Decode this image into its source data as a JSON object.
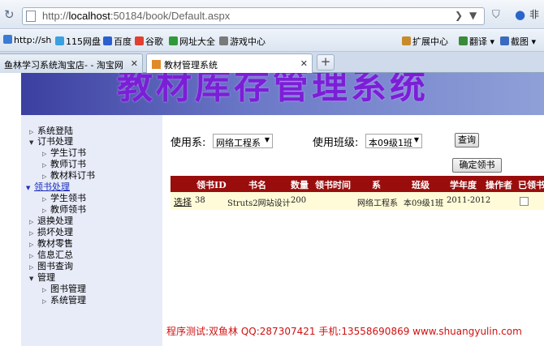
{
  "browser": {
    "url_prefix": "http://",
    "url_host": "localhost",
    "url_rest": ":50184/book/Default.aspx",
    "right_icon": "非"
  },
  "bookmarks": [
    {
      "label": "http://sh",
      "color": "#3a7bd5"
    },
    {
      "label": "115网盘",
      "color": "#3aa0e0"
    },
    {
      "label": "百度",
      "color": "#2b5fd0"
    },
    {
      "label": "谷歌",
      "color": "#e04030"
    },
    {
      "label": "网址大全",
      "color": "#2f9a3a"
    },
    {
      "label": "游戏中心",
      "color": "#7a7a7a"
    }
  ],
  "bookmark_tools": [
    "扩展中心",
    "翻译",
    "截图"
  ],
  "tabs": [
    {
      "label": "鱼林学习系统淘宝店- - 淘宝网"
    },
    {
      "label": "教材管理系统"
    }
  ],
  "banner_title": "教材库存管理系统",
  "sidebar": {
    "items": [
      {
        "label": "系统登陆",
        "level": 0,
        "expanded": false
      },
      {
        "label": "订书处理",
        "level": 0,
        "expanded": true
      },
      {
        "label": "学生订书",
        "level": 1
      },
      {
        "label": "教师订书",
        "level": 1
      },
      {
        "label": "教材料订书",
        "level": 1
      },
      {
        "label": "领书处理",
        "level": 0,
        "expanded": true,
        "selected": true
      },
      {
        "label": "学生领书",
        "level": 1
      },
      {
        "label": "教师领书",
        "level": 1
      },
      {
        "label": "退换处理",
        "level": 0
      },
      {
        "label": "损坏处理",
        "level": 0
      },
      {
        "label": "教材零售",
        "level": 0
      },
      {
        "label": "信息汇总",
        "level": 0
      },
      {
        "label": "图书查询",
        "level": 0
      },
      {
        "label": "管理",
        "level": 0,
        "expanded": true
      },
      {
        "label": "图书管理",
        "level": 1
      },
      {
        "label": "系统管理",
        "level": 1
      }
    ]
  },
  "filters": {
    "dept_label": "使用系:",
    "dept_value": "网络工程系",
    "class_label": "使用班级:",
    "class_value": "本09级1班",
    "query_button": "查询",
    "confirm_button": "确定领书"
  },
  "grid": {
    "columns": [
      "领书ID",
      "书名",
      "数量",
      "领书时间",
      "系",
      "班级",
      "学年度",
      "操作者",
      "已领书"
    ],
    "rows": [
      {
        "action": "选择",
        "id": "38",
        "book": "Struts2网站设计",
        "qty": "200",
        "time": "",
        "dept": "网络工程系",
        "class": "本09级1班",
        "year": "2011-2012",
        "operator": "",
        "received": false
      }
    ]
  },
  "footer_text": "程序测试:双鱼林 QQ:287307421 手机:13558690869 www.shuangyulin.com"
}
